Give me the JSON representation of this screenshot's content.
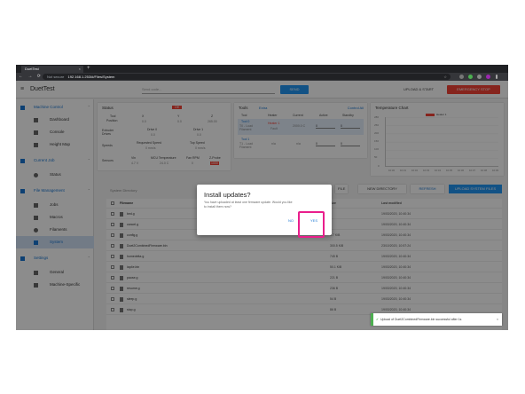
{
  "browser": {
    "tab_title": "DuetTest",
    "tab_close": "×",
    "new_tab": "+",
    "nav": "← → ⟳",
    "security": "Not secure",
    "url": "192.168.1.253/#/Files/System"
  },
  "app": {
    "title": "DuetTest",
    "gcode_placeholder": "Send code...",
    "send_label": "SEND",
    "upload_start_label": "UPLOAD & START",
    "emergency_label": "EMERGENCY STOP"
  },
  "sidebar": {
    "sections": [
      {
        "label": "Machine Control",
        "items": [
          "Dashboard",
          "Console",
          "Height Map"
        ]
      },
      {
        "label": "Current Job",
        "items": [
          "Status"
        ]
      },
      {
        "label": "File Management",
        "items": [
          "Jobs",
          "Macros",
          "Filaments",
          "System"
        ]
      },
      {
        "label": "Settings",
        "items": [
          "General",
          "Machine-Specific"
        ]
      }
    ]
  },
  "status_card": {
    "title": "Status",
    "badge": "Off",
    "tool_label": "Tool",
    "position_label": "Position",
    "axes": [
      "X",
      "Y",
      "Z"
    ],
    "axis_values": [
      "0.0",
      "0.0",
      "265.00"
    ],
    "extruder_label": "Extruder Drives",
    "drive0": "Drive 0",
    "drive1": "Drive 1",
    "drive0_val": "0.0",
    "drive1_val": "0.0",
    "speeds_label": "Speeds",
    "requested_speed": "Requested Speed",
    "top_speed": "Top Speed",
    "requested_val": "0 mm/s",
    "top_val": "0 mm/s",
    "sensors_label": "Sensors",
    "vin": "Vin",
    "mcu_temp": "MCU Temperature",
    "fan_rpm": "Fan RPM",
    "zprobe": "Z-Probe",
    "vin_val": "4.7 V",
    "mcu_val": "24.0 C",
    "fan_val": "0",
    "zprobe_val": "1000"
  },
  "tools_card": {
    "title": "Tools",
    "extra": "Extra",
    "control_all": "Control All",
    "cols": [
      "Tool",
      "Heater",
      "Current",
      "Active",
      "Standby"
    ],
    "rows": [
      {
        "tool": "Tool 0",
        "sub": "T0 - Load Filament",
        "heater": "Heater 1",
        "heater_state": "Fault",
        "current": "2000.0 C",
        "active": "0",
        "standby": "0"
      },
      {
        "tool": "Tool 1",
        "sub": "T1 - Load Filament",
        "heater": "n/a",
        "heater_state": "",
        "current": "n/a",
        "active": "0",
        "standby": "0"
      }
    ]
  },
  "temp_chart": {
    "title": "Temperature Chart",
    "legend": "Heater 1",
    "y_ticks": [
      "280",
      "250",
      "200",
      "150",
      "100",
      "50",
      "0"
    ],
    "x_ticks": [
      "10:30",
      "10:31",
      "10:32",
      "10:33",
      "10:34",
      "10:35",
      "10:36",
      "10:37",
      "10:38",
      "10:39"
    ]
  },
  "file_toolbar": {
    "directory_label": "System Directory",
    "new_file": "FILE",
    "new_directory": "NEW DIRECTORY",
    "refresh": "REFRESH",
    "upload_system": "UPLOAD SYSTEM FILES"
  },
  "files": {
    "col_name": "Filename",
    "col_size": "Size",
    "col_modified": "Last modified",
    "rows": [
      {
        "name": "bed.g",
        "size": "",
        "date": "19/03/2020, 10:40:34"
      },
      {
        "name": "cancel.g",
        "size": "",
        "date": "19/03/2020, 10:40:34"
      },
      {
        "name": "config.g",
        "size": "3.7 KiB",
        "date": "19/03/2020, 10:40:34"
      },
      {
        "name": "Duet2CombinedFirmware.bin",
        "size": "300.5 KiB",
        "date": "23/10/2020, 10:57:24"
      },
      {
        "name": "homedelta.g",
        "size": "745 B",
        "date": "19/03/2020, 10:40:34"
      },
      {
        "name": "iap4e.bin",
        "size": "50.1 KiB",
        "date": "19/03/2020, 10:40:34"
      },
      {
        "name": "pause.g",
        "size": "221 B",
        "date": "19/03/2020, 10:40:34"
      },
      {
        "name": "resume.g",
        "size": "236 B",
        "date": "19/03/2020, 10:40:34"
      },
      {
        "name": "sleep.g",
        "size": "54 B",
        "date": "19/03/2020, 10:40:34"
      },
      {
        "name": "stop.g",
        "size": "86 B",
        "date": "19/03/2020, 10:40:34"
      }
    ]
  },
  "dialog": {
    "title": "Install updates?",
    "body": "You have uploaded at least one firmware update. Would you like to install them now?",
    "no": "NO",
    "yes": "YES"
  },
  "toast": {
    "check": "✔",
    "message": "Upload of Duet2CombinedFirmware.bin successful after 1s",
    "close": "×"
  },
  "colors": {
    "accent": "#2196f3",
    "danger": "#f44336",
    "highlight": "#e91e8c",
    "success": "#4caf50"
  }
}
